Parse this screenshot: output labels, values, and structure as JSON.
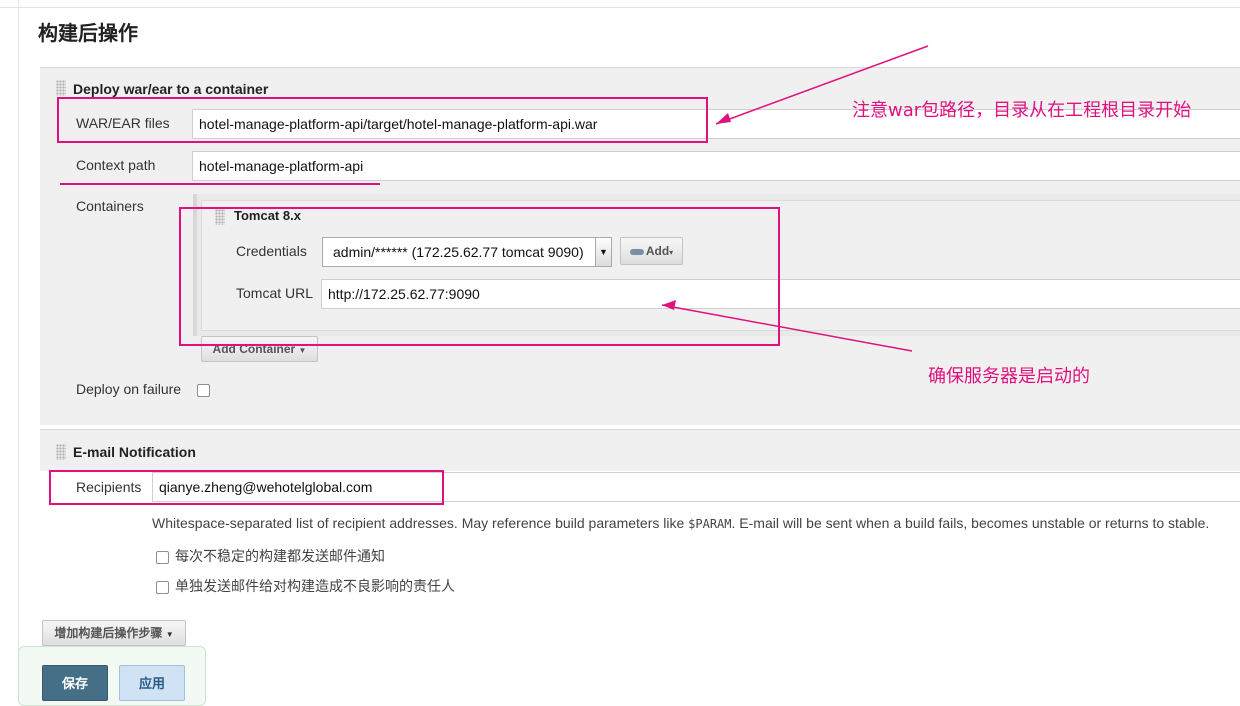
{
  "page_title": "构建后操作",
  "deploy": {
    "section_title": "Deploy war/ear to a container",
    "war_label": "WAR/EAR files",
    "war_value": "hotel-manage-platform-api/target/hotel-manage-platform-api.war",
    "context_label": "Context path",
    "context_value": "hotel-manage-platform-api",
    "containers_label": "Containers",
    "container": {
      "title": "Tomcat 8.x",
      "credentials_label": "Credentials",
      "credentials_value": "admin/****** (172.25.62.77 tomcat 9090)",
      "add_label": "Add",
      "url_label": "Tomcat URL",
      "url_value": "http://172.25.62.77:9090"
    },
    "add_container_label": "Add Container",
    "deploy_on_failure_label": "Deploy on failure"
  },
  "email": {
    "section_title": "E-mail Notification",
    "recipients_label": "Recipients",
    "recipients_value": "qianye.zheng@wehotelglobal.com",
    "help_before": "Whitespace-separated list of recipient addresses. May reference build parameters like ",
    "help_param": "$PARAM",
    "help_after": ". E-mail will be sent when a build fails, becomes unstable or returns to stable.",
    "checkbox1_label": "每次不稳定的构建都发送邮件通知",
    "checkbox2_label": "单独发送邮件给对构建造成不良影响的责任人"
  },
  "add_post_build_label": "增加构建后操作步骤",
  "save_label": "保存",
  "apply_label": "应用",
  "annotations": {
    "war_note": "注意war包路径，目录从在工程根目录开始",
    "server_note": "确保服务器是启动的"
  },
  "colors": {
    "annotation": "#e0117f",
    "save_button": "#456f87",
    "apply_button": "#cfe3f5"
  }
}
